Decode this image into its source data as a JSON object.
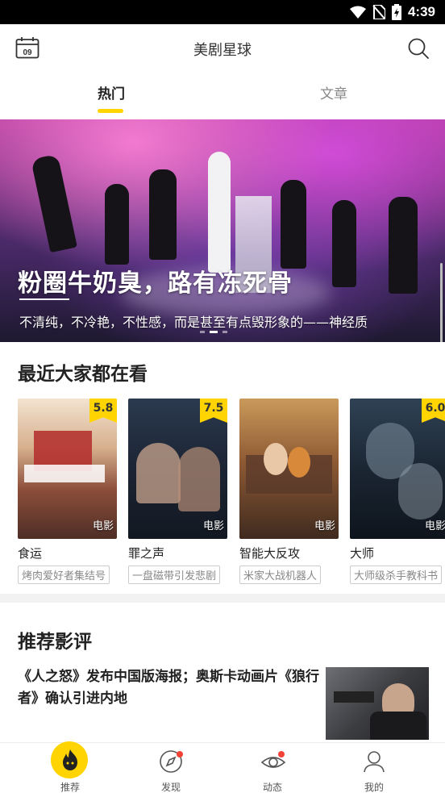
{
  "status_bar": {
    "time": "4:39"
  },
  "app_bar": {
    "title": "美剧星球",
    "calendar_day": "09"
  },
  "tabs": [
    {
      "label": "热门",
      "active": true
    },
    {
      "label": "文章",
      "active": false
    }
  ],
  "banner": {
    "title": "粉圈牛奶臭，路有冻死骨",
    "subtitle": "不清纯，不冷艳，不性感，而是甚至有点毁形象的——神经质"
  },
  "watching": {
    "title": "最近大家都在看",
    "movies": [
      {
        "name": "食运",
        "tag": "烤肉爱好者集结号",
        "score": "5.8",
        "type": "电影"
      },
      {
        "name": "罪之声",
        "tag": "一盘磁带引发悲剧",
        "score": "7.5",
        "type": "电影"
      },
      {
        "name": "智能大反攻",
        "tag": "米家大战机器人",
        "score": "",
        "type": "电影"
      },
      {
        "name": "大师",
        "tag": "大师级杀手教科书",
        "score": "6.0",
        "type": "电影"
      }
    ]
  },
  "reviews": {
    "title": "推荐影评",
    "items": [
      {
        "text": "《人之怒》发布中国版海报；奥斯卡动画片《狼行者》确认引进内地"
      }
    ]
  },
  "bottom_nav": [
    {
      "label": "推荐",
      "icon": "flame-icon",
      "active": true
    },
    {
      "label": "发现",
      "icon": "compass-icon",
      "badge": true
    },
    {
      "label": "动态",
      "icon": "eye-icon",
      "badge": true
    },
    {
      "label": "我的",
      "icon": "user-icon"
    }
  ],
  "colors": {
    "accent": "#ffd400",
    "badge": "#f44336"
  }
}
